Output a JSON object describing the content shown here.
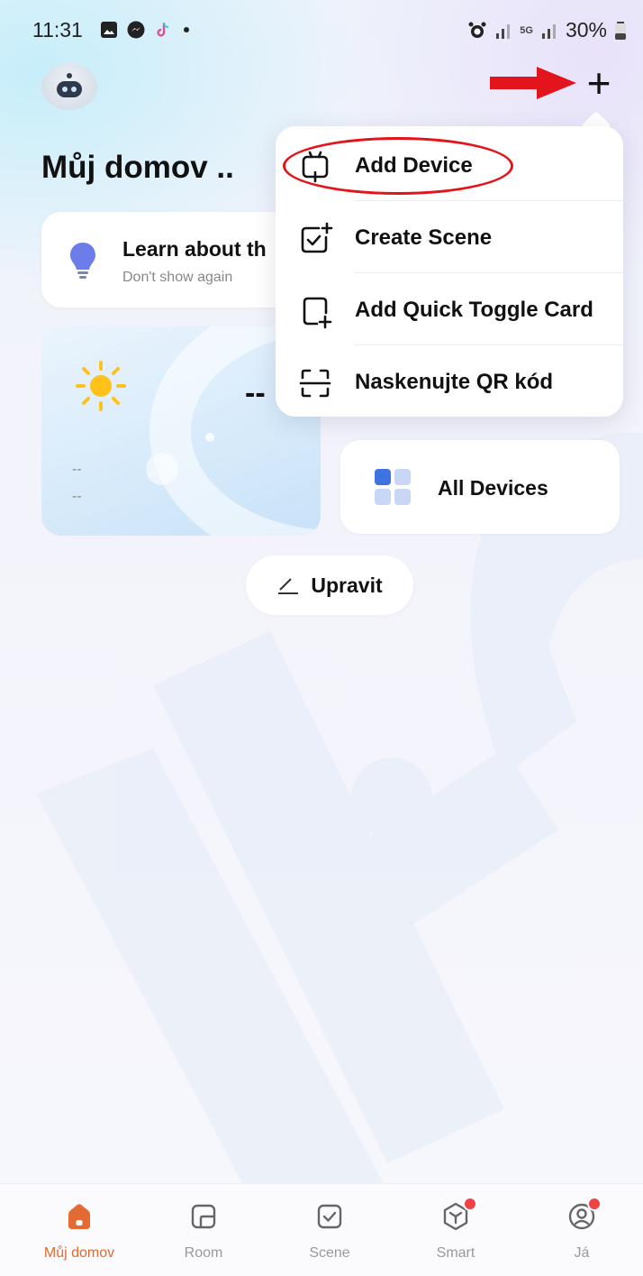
{
  "status_bar": {
    "time": "11:31",
    "network": "5G",
    "battery": "30%"
  },
  "header": {
    "home_title": "Můj domov ..",
    "add_button_symbol": "+"
  },
  "learn_card": {
    "title": "Learn about th",
    "subtitle": "Don't show again"
  },
  "weather_card": {
    "temperature": "--",
    "line1": "--",
    "line2": "--"
  },
  "all_devices": {
    "label": "All Devices"
  },
  "edit": {
    "label": "Upravit"
  },
  "menu": {
    "items": [
      {
        "label": "Add Device",
        "icon": "device-monitor-icon",
        "highlighted": true
      },
      {
        "label": "Create Scene",
        "icon": "scene-add-icon"
      },
      {
        "label": "Add Quick Toggle Card",
        "icon": "card-add-icon"
      },
      {
        "label": "Naskenujte QR kód",
        "icon": "scan-qr-icon"
      }
    ]
  },
  "bottom_nav": {
    "items": [
      {
        "label": "Můj domov",
        "icon": "home-icon",
        "active": true
      },
      {
        "label": "Room",
        "icon": "room-icon"
      },
      {
        "label": "Scene",
        "icon": "scene-icon"
      },
      {
        "label": "Smart",
        "icon": "smart-icon",
        "badge": true
      },
      {
        "label": "Já",
        "icon": "profile-icon",
        "badge": true
      }
    ]
  },
  "colors": {
    "accent": "#e36a32",
    "annotation_red": "#e3141c",
    "badge_red": "#ef4343",
    "icon_blue": "#3f74e0"
  }
}
